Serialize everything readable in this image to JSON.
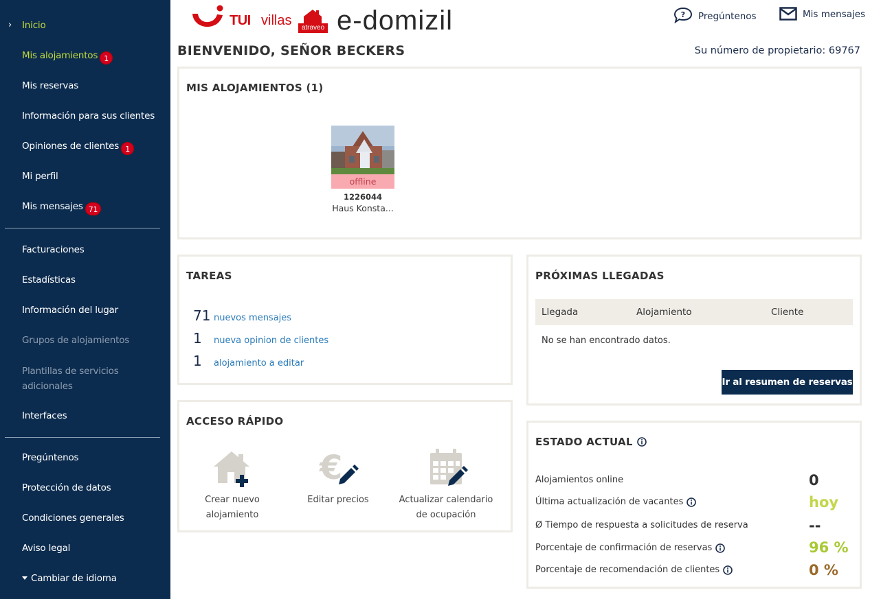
{
  "sidebar": {
    "items": [
      {
        "label": "Inicio",
        "active": true
      },
      {
        "label": "Mis alojamientos",
        "active": true,
        "badge": "1"
      },
      {
        "label": "Mis reservas"
      },
      {
        "label": "Información para sus clientes"
      },
      {
        "label": "Opiniones de clientes",
        "badge": "1"
      },
      {
        "label": "Mi perfil"
      },
      {
        "label": "Mis mensajes",
        "badge": "71"
      },
      {
        "label": "Facturaciones"
      },
      {
        "label": "Estadísticas"
      },
      {
        "label": "Información del lugar"
      },
      {
        "label": "Grupos de alojamientos",
        "disabled": true
      },
      {
        "label": "Plantillas de servicios adicionales",
        "disabled": true
      },
      {
        "label": "Interfaces"
      },
      {
        "label": "Pregúntenos"
      },
      {
        "label": "Protección de datos"
      },
      {
        "label": "Condiciones generales"
      },
      {
        "label": "Aviso legal"
      },
      {
        "label": "Cambiar de idioma"
      }
    ]
  },
  "header": {
    "tui": "TUI",
    "villas": "villas",
    "atraveo": "atraveo",
    "edomizil": "e-domizil",
    "ask_label": "Pregúntenos",
    "messages_label": "Mis mensajes",
    "welcome": "BIENVENIDO, SEÑOR BECKERS",
    "owner_number": "Su número de propietario: 69767"
  },
  "accommodations": {
    "title": "MIS ALOJAMIENTOS (1)",
    "items": [
      {
        "status": "offline",
        "id": "1226044",
        "name": "Haus Konsta..."
      }
    ]
  },
  "tasks": {
    "title": "TAREAS",
    "rows": [
      {
        "count": "71",
        "label": "nuevos mensajes"
      },
      {
        "count": "1",
        "label": "nueva opinion de clientes"
      },
      {
        "count": "1",
        "label": "alojamiento a editar"
      }
    ]
  },
  "quick_access": {
    "title": "ACCESO RÁPIDO",
    "items": [
      {
        "label": "Crear nuevo alojamiento",
        "icon": "house-plus-icon"
      },
      {
        "label": "Editar precios",
        "icon": "euro-edit-icon"
      },
      {
        "label": "Actualizar calendario de ocupación",
        "icon": "calendar-edit-icon"
      }
    ]
  },
  "arrivals": {
    "title": "PRÓXIMAS LLEGADAS",
    "columns": [
      "Llegada",
      "Alojamiento",
      "Cliente"
    ],
    "empty": "No se han encontrado datos.",
    "button": "Ir al resumen de reservas"
  },
  "status": {
    "title": "ESTADO ACTUAL",
    "rows": [
      {
        "label": "Alojamientos online",
        "value": "0",
        "color": "#333333",
        "info": false
      },
      {
        "label": "Última actualización de vacantes",
        "value": "hoy",
        "color": "#c4d64a",
        "info": true
      },
      {
        "label": "Ø Tiempo de respuesta a solicitudes de reserva",
        "value": "--",
        "color": "#333333",
        "info": false
      },
      {
        "label": "Porcentaje de confirmación de reservas",
        "value": "96 %",
        "color": "#a9c934",
        "info": true
      },
      {
        "label": "Porcentaje de recomendación de clientes",
        "value": "0 %",
        "color": "#9a6a2a",
        "info": true
      }
    ]
  },
  "colors": {
    "sidebar": "#0c2c4f",
    "accent": "#c4dc3c",
    "badge": "#d3001e",
    "link": "#2b7bb9"
  }
}
